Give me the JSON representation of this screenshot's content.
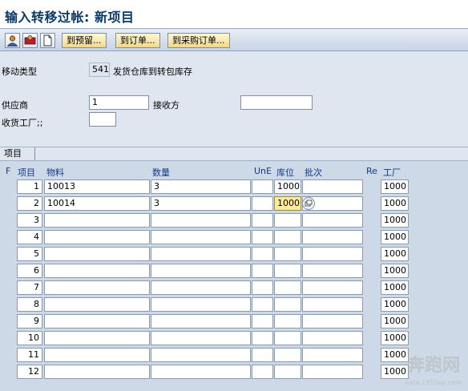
{
  "window": {
    "title": "输入转移过帐: 新项目"
  },
  "toolbar": {
    "icons": [
      "user-icon",
      "person-icon",
      "document-icon"
    ],
    "btn_reservation": "到预留...",
    "btn_order": "到订单...",
    "btn_po": "到采购订单..."
  },
  "header": {
    "movement_type_label": "移动类型",
    "movement_type_code": "541",
    "movement_type_desc": "发货仓库到转包库存",
    "vendor_label": "供应商",
    "vendor_value": "1",
    "receiver_label": "接收方",
    "receiver_value": "",
    "plant_label": "收货工厂;;",
    "plant_value": ""
  },
  "tab": {
    "label": "项目"
  },
  "grid": {
    "columns": {
      "f": "F",
      "item": "项目",
      "material": "物料",
      "qty": "数量",
      "une": "UnE",
      "sloc": "库位",
      "batch": "批次",
      "re": "Re",
      "plant": "工厂"
    },
    "rows": [
      {
        "n": "1",
        "material": "10013",
        "qty": "3",
        "sloc": "1000",
        "batch": "",
        "plant": "1000"
      },
      {
        "n": "2",
        "material": "10014",
        "qty": "3",
        "sloc": "1000",
        "batch": "",
        "plant": "1000"
      },
      {
        "n": "3",
        "material": "",
        "qty": "",
        "sloc": "",
        "batch": "",
        "plant": "1000"
      },
      {
        "n": "4",
        "material": "",
        "qty": "",
        "sloc": "",
        "batch": "",
        "plant": "1000"
      },
      {
        "n": "5",
        "material": "",
        "qty": "",
        "sloc": "",
        "batch": "",
        "plant": "1000"
      },
      {
        "n": "6",
        "material": "",
        "qty": "",
        "sloc": "",
        "batch": "",
        "plant": "1000"
      },
      {
        "n": "7",
        "material": "",
        "qty": "",
        "sloc": "",
        "batch": "",
        "plant": "1000"
      },
      {
        "n": "8",
        "material": "",
        "qty": "",
        "sloc": "",
        "batch": "",
        "plant": "1000"
      },
      {
        "n": "9",
        "material": "",
        "qty": "",
        "sloc": "",
        "batch": "",
        "plant": "1000"
      },
      {
        "n": "10",
        "material": "",
        "qty": "",
        "sloc": "",
        "batch": "",
        "plant": "1000"
      },
      {
        "n": "11",
        "material": "",
        "qty": "",
        "sloc": "",
        "batch": "",
        "plant": "1000"
      },
      {
        "n": "12",
        "material": "",
        "qty": "",
        "sloc": "",
        "batch": "",
        "plant": "1000"
      }
    ]
  },
  "watermark": {
    "main": "奔跑网",
    "sub": "www.131Sap.com"
  }
}
